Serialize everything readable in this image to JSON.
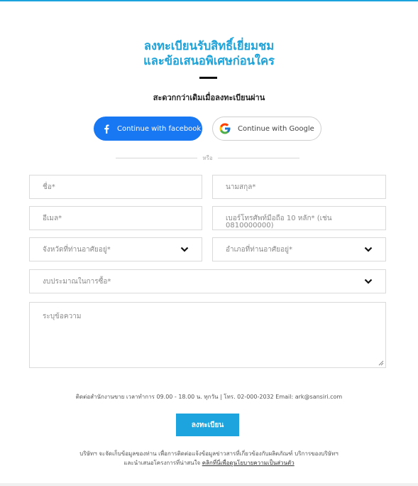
{
  "header": {
    "title_line1": "ลงทะเบียนรับสิทธิ์เยี่ยมชม",
    "title_line2": "และข้อเสนอพิเศษก่อนใคร",
    "subtitle": "สะดวกกว่าเดิมเมื่อลงทะเบียนผ่าน"
  },
  "social": {
    "facebook_label": "Continue with facebook",
    "google_label": "Continue with Google",
    "or_text": "หรือ"
  },
  "form": {
    "first_name": "ชื่อ*",
    "last_name": "นามสกุล*",
    "email": "อีเมล*",
    "phone": "เบอร์โทรศัพท์มือถือ 10 หลัก* (เช่น 0810000000)",
    "province": "จังหวัดที่ท่านอาศัยอยู่*",
    "district": "อำเภอที่ท่านอาศัยอยู่*",
    "budget": "งบประมาณในการซื้อ*",
    "message": "ระบุข้อความ"
  },
  "footer": {
    "contact": "ติดต่อสำนักงานขาย เวลาทำการ 09.00 - 18.00 น. ทุกวัน | โทร. 02-000-2032 Email: ark@sansiri.com",
    "submit_label": "ลงทะเบียน",
    "privacy_line1": "บริษัทฯ จะจัดเก็บข้อมูลของท่าน เพื่อการติดต่อแจ้งข้อมูลข่าวสารที่เกี่ยวข้องกับผลิตภัณฑ์ บริการของบริษัทฯ",
    "privacy_line2_prefix": "และนำเสนอโครงการที่น่าสนใจ ",
    "privacy_link": "คลิกที่นี่เพื่อดูนโยบายความเป็นส่วนตัว"
  },
  "colors": {
    "accent": "#1ea3d9",
    "facebook": "#1877f2"
  },
  "icons": {
    "facebook": "facebook-icon",
    "google": "google-icon",
    "dropdown": "chevron-down-icon"
  }
}
